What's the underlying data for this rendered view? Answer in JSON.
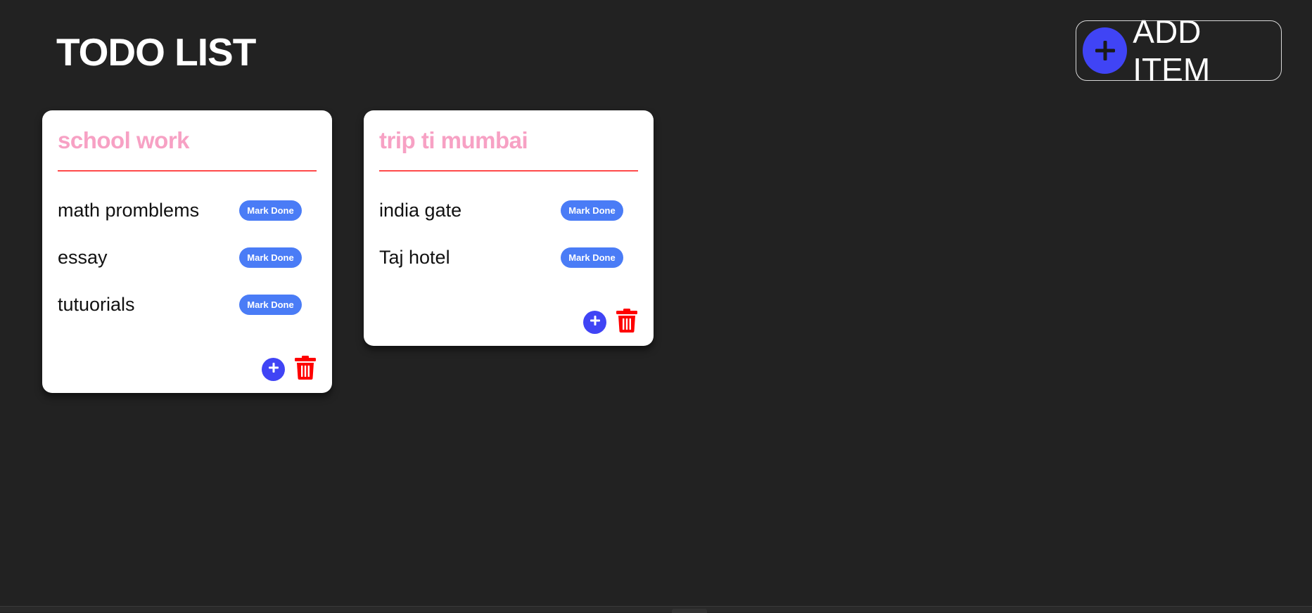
{
  "header": {
    "title": "TODO LIST",
    "add_item_label": "ADD ITEM"
  },
  "colors": {
    "background": "#222222",
    "accent_blue": "#4044f5",
    "mark_done_blue": "#4a7cf6",
    "card_title_pink": "#f7a1c4",
    "divider_red": "#ff4a4a",
    "delete_red": "#ff0000"
  },
  "icons": {
    "add_item": "plus-icon",
    "card_add": "plus-icon",
    "card_delete": "trash-icon"
  },
  "cards": [
    {
      "title": "school work",
      "items": [
        {
          "text": "math promblems",
          "action": "Mark Done"
        },
        {
          "text": "essay",
          "action": "Mark Done"
        },
        {
          "text": "tutuorials",
          "action": "Mark Done"
        }
      ]
    },
    {
      "title": "trip ti mumbai",
      "items": [
        {
          "text": "india gate",
          "action": "Mark Done"
        },
        {
          "text": "Taj hotel",
          "action": "Mark Done"
        }
      ]
    }
  ]
}
